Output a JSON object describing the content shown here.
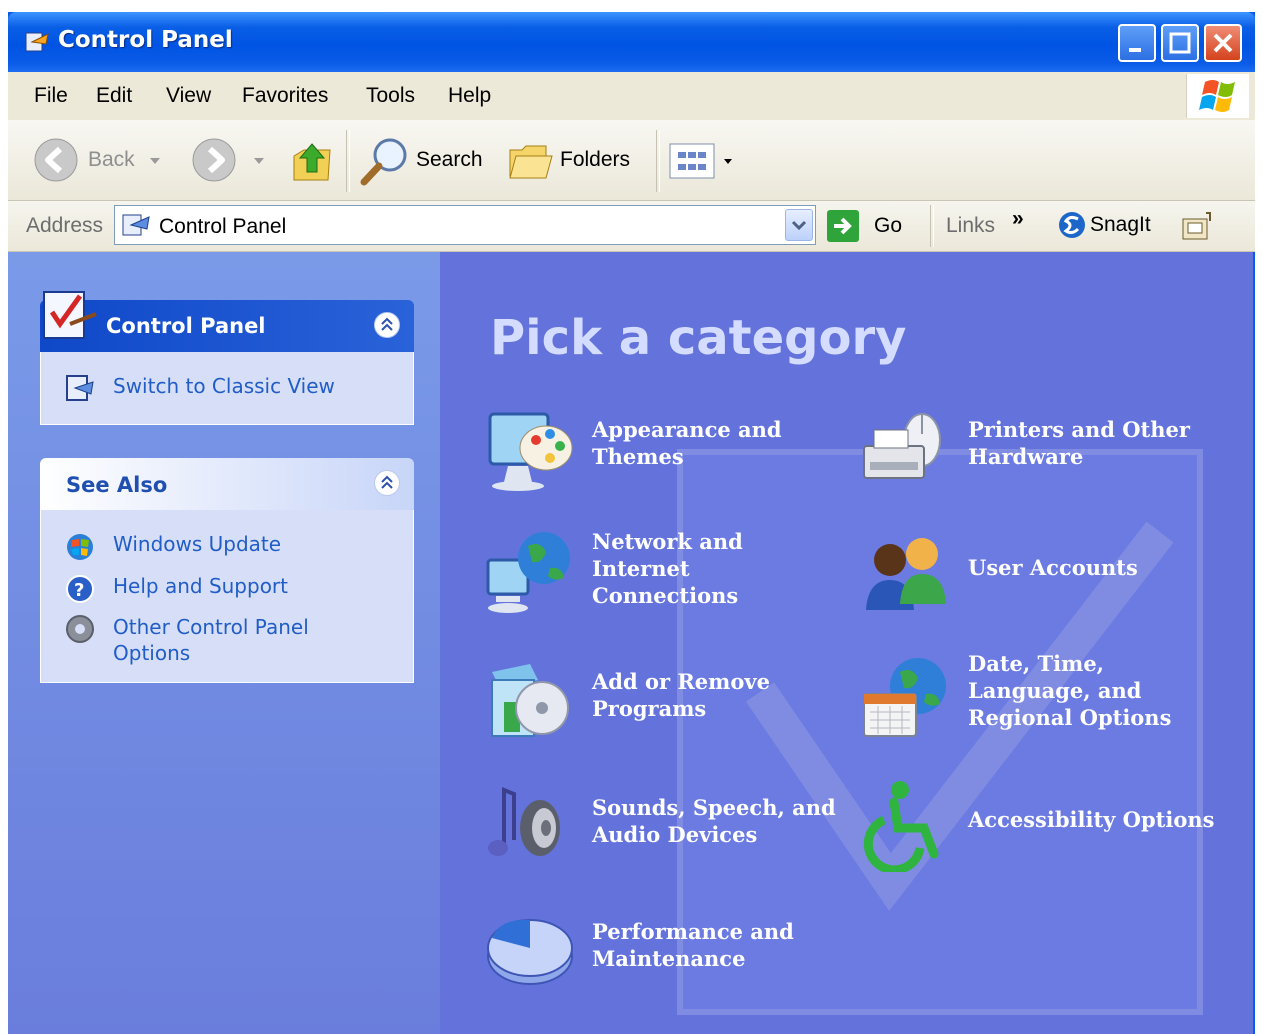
{
  "window": {
    "title": "Control Panel"
  },
  "menu": [
    "File",
    "Edit",
    "View",
    "Favorites",
    "Tools",
    "Help"
  ],
  "toolbar": {
    "back": "Back",
    "search": "Search",
    "folders": "Folders"
  },
  "address": {
    "label": "Address",
    "value": "Control Panel",
    "go": "Go",
    "links": "Links",
    "chevrons": "»",
    "snagit": "SnagIt"
  },
  "sidebar": {
    "control_panel": {
      "title": "Control Panel",
      "switch": "Switch to Classic View"
    },
    "see_also": {
      "title": "See Also",
      "items": [
        "Windows Update",
        "Help and Support",
        "Other Control Panel Options"
      ]
    }
  },
  "main": {
    "heading": "Pick a category",
    "categories": [
      {
        "label": "Appearance and Themes"
      },
      {
        "label": "Printers and Other Hardware"
      },
      {
        "label": "Network and Internet Connections"
      },
      {
        "label": "User Accounts"
      },
      {
        "label": "Add or Remove Programs"
      },
      {
        "label": "Date, Time, Language, and Regional Options"
      },
      {
        "label": "Sounds, Speech, and Audio Devices"
      },
      {
        "label": "Accessibility Options"
      },
      {
        "label": "Performance and Maintenance"
      }
    ]
  },
  "colors": {
    "titlebar": "#0054e3",
    "sidebar_blue": "#7a9ae8",
    "content_blue": "#6473dc",
    "link": "#215dc6"
  }
}
